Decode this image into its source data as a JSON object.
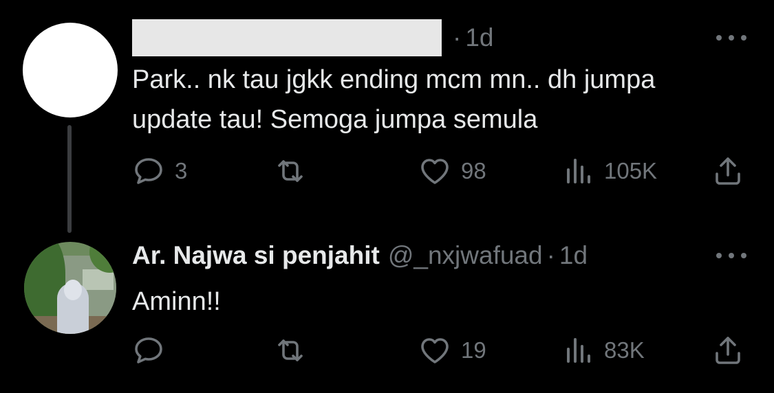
{
  "tweets": [
    {
      "avatar": "blank-avatar",
      "display_name": "",
      "handle": "",
      "separator": "·",
      "time": "1d",
      "text_lines": [
        "Park.. nk tau jgkk ending mcm mn.. dh jumpa",
        "update tau! Semoga jumpa semula"
      ],
      "reply_count": "3",
      "retweet_count": "",
      "like_count": "98",
      "view_count": "105K"
    },
    {
      "avatar": "photo-avatar",
      "display_name": "Ar. Najwa si penjahit",
      "handle": "@_nxjwafuad",
      "separator": "·",
      "time": "1d",
      "text_lines": [
        "Aminn!!"
      ],
      "reply_count": "",
      "retweet_count": "",
      "like_count": "19",
      "view_count": "83K"
    }
  ],
  "icons": {
    "reply": "reply-icon",
    "retweet": "retweet-icon",
    "like": "heart-icon",
    "views": "views-icon",
    "share": "share-icon",
    "more": "more-icon"
  },
  "colors": {
    "background": "#000000",
    "text_primary": "#e7e9ea",
    "text_secondary": "#71767b",
    "thread_line": "#3b3d40",
    "redaction": "#e7e7e7"
  }
}
